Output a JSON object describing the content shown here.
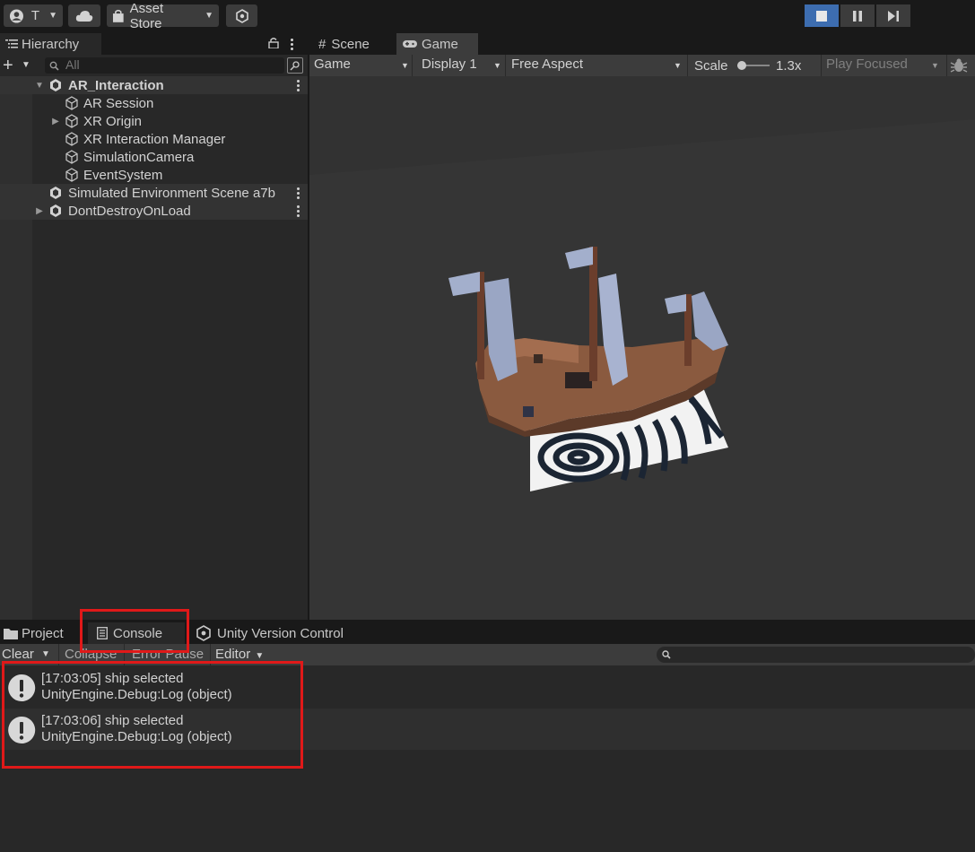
{
  "toolbar": {
    "account_label": "T",
    "asset_store_label": "Asset Store"
  },
  "hierarchy": {
    "tab_label": "Hierarchy",
    "search_placeholder": "All",
    "items": [
      {
        "label": "AR_Interaction"
      },
      {
        "label": "AR Session"
      },
      {
        "label": "XR Origin"
      },
      {
        "label": "XR Interaction Manager"
      },
      {
        "label": "SimulationCamera"
      },
      {
        "label": "EventSystem"
      },
      {
        "label": "Simulated Environment Scene a7b"
      },
      {
        "label": "DontDestroyOnLoad"
      }
    ]
  },
  "game_view": {
    "tabs": [
      {
        "label": "Scene"
      },
      {
        "label": "Game"
      }
    ],
    "mode_select": "Game",
    "display_select": "Display 1",
    "aspect_select": "Free Aspect",
    "scale_label": "Scale",
    "scale_value": "1.3x",
    "play_mode_select": "Play Focused"
  },
  "bottom_panel": {
    "tabs": [
      {
        "label": "Project"
      },
      {
        "label": "Console"
      },
      {
        "label": "Unity Version Control"
      }
    ],
    "console_toolbar": {
      "clear": "Clear",
      "collapse": "Collapse",
      "error_pause": "Error Pause",
      "editor": "Editor"
    },
    "logs": [
      {
        "line1": "[17:03:05] ship selected",
        "line2": "UnityEngine.Debug:Log (object)"
      },
      {
        "line1": "[17:03:06] ship selected",
        "line2": "UnityEngine.Debug:Log (object)"
      }
    ]
  },
  "colors": {
    "highlight": "#e01919",
    "play_active": "#3d6db0"
  }
}
